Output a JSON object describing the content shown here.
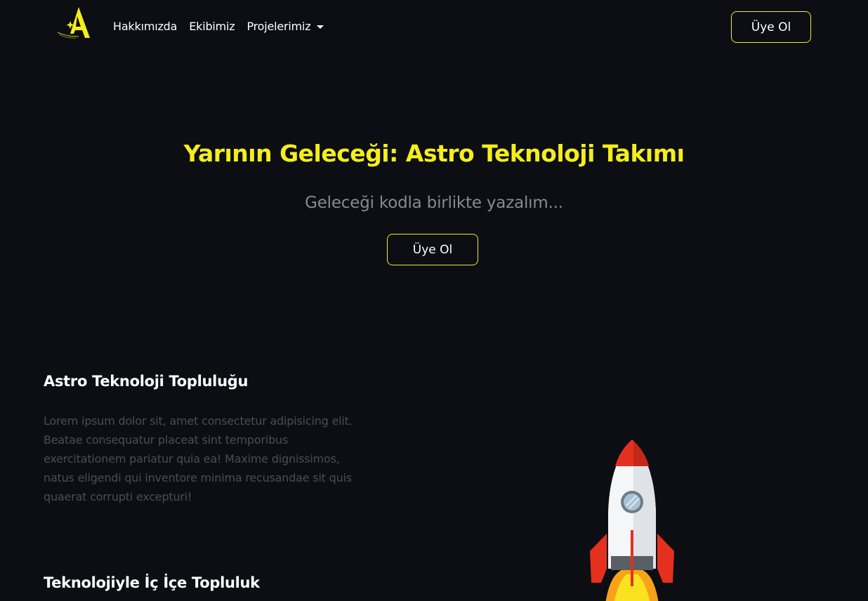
{
  "nav": {
    "brand_name": "Astro Technology",
    "links": [
      {
        "label": "Hakkımızda"
      },
      {
        "label": "Ekibimiz"
      },
      {
        "label": "Projelerimiz"
      }
    ],
    "cta_label": "Üye Ol"
  },
  "hero": {
    "title": "Yarının Geleceği: Astro Teknoloji Takımı",
    "subtitle": "Geleceği kodla birlikte yazalım...",
    "cta_label": "Üye Ol"
  },
  "about": {
    "title": "Astro Teknoloji Topluluğu",
    "text": "Lorem ipsum dolor sit, amet consectetur adipisicing elit. Beatae consequatur placeat sint temporibus exercitationem pariatur quia ea! Maxime dignissimos, natus eligendi qui inventore minima recusandae sit quis quaerat corrupti excepturi!"
  },
  "tech": {
    "title": "Teknolojiyle İç İçe Topluluk"
  },
  "colors": {
    "background": "#0c0e14",
    "accent": "#f4ee1a",
    "subtitle": "#8a8a8a",
    "body_text": "#4b4d52"
  },
  "icons": {
    "logo": "astro-a-logo-icon",
    "dropdown": "caret-down-icon",
    "illustration": "rocket-icon"
  }
}
